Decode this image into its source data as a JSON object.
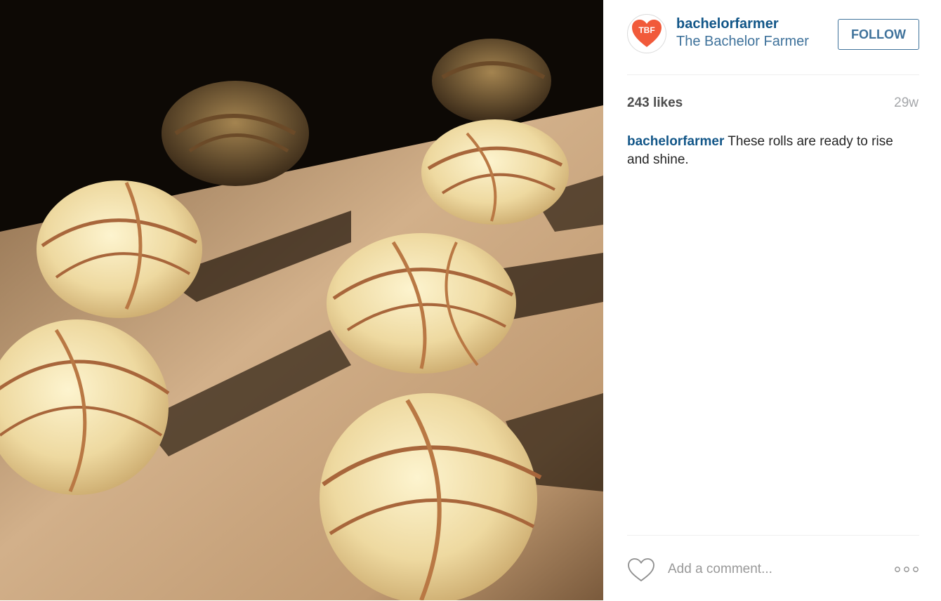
{
  "post": {
    "image_alt": "Braided dough rolls on parchment paper in sunlight",
    "image_colors": {
      "dough": "#f1dfa6",
      "dough_highlight": "#fbf0c8",
      "stripe": "#a8663b",
      "parchment": "#c7a57f",
      "shadow": "#2a1c10"
    }
  },
  "profile": {
    "username": "bachelorfarmer",
    "full_name": "The Bachelor Farmer",
    "avatar_initials": "TBF",
    "avatar_color": "#f15a3a",
    "follow_label": "FOLLOW"
  },
  "stats": {
    "likes": "243 likes",
    "age": "29w"
  },
  "caption": {
    "username": "bachelorfarmer",
    "text": "These rolls are ready to rise and shine."
  },
  "comment": {
    "placeholder": "Add a comment..."
  },
  "icons": {
    "like": "heart-icon",
    "more": "more-options-icon"
  }
}
